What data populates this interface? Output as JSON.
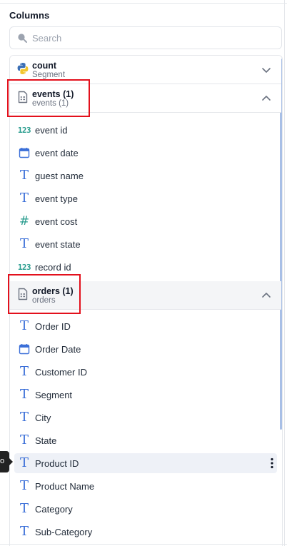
{
  "panel": {
    "title": "Columns"
  },
  "search": {
    "placeholder": "Search",
    "value": ""
  },
  "groups": [
    {
      "name": "count",
      "subtitle": "Segment",
      "icon": "python-icon",
      "expanded": false
    },
    {
      "name": "events (1)",
      "subtitle": "events (1)",
      "icon": "table-icon",
      "expanded": true,
      "fields": [
        {
          "label": "event id",
          "type": "number-icon"
        },
        {
          "label": "event date",
          "type": "calendar-icon"
        },
        {
          "label": "guest name",
          "type": "text-icon"
        },
        {
          "label": "event type",
          "type": "text-icon"
        },
        {
          "label": "event cost",
          "type": "hash-icon"
        },
        {
          "label": "event state",
          "type": "text-icon"
        },
        {
          "label": "record id",
          "type": "number-icon"
        }
      ]
    },
    {
      "name": "orders (1)",
      "subtitle": "orders",
      "icon": "table-icon",
      "expanded": true,
      "fields": [
        {
          "label": "Order ID",
          "type": "text-icon"
        },
        {
          "label": "Order Date",
          "type": "calendar-icon"
        },
        {
          "label": "Customer ID",
          "type": "text-icon"
        },
        {
          "label": "Segment",
          "type": "text-icon"
        },
        {
          "label": "City",
          "type": "text-icon"
        },
        {
          "label": "State",
          "type": "text-icon"
        },
        {
          "label": "Product ID",
          "type": "text-icon",
          "hovered": true
        },
        {
          "label": "Product Name",
          "type": "text-icon"
        },
        {
          "label": "Category",
          "type": "text-icon"
        },
        {
          "label": "Sub-Category",
          "type": "text-icon"
        }
      ]
    }
  ],
  "tooltip": {
    "fragment": "o"
  },
  "colors": {
    "text_icon": "#3b6fd8",
    "number_icon": "#2a9d8f",
    "highlight_box": "#e3101c",
    "hover_row": "#eef1f7"
  }
}
